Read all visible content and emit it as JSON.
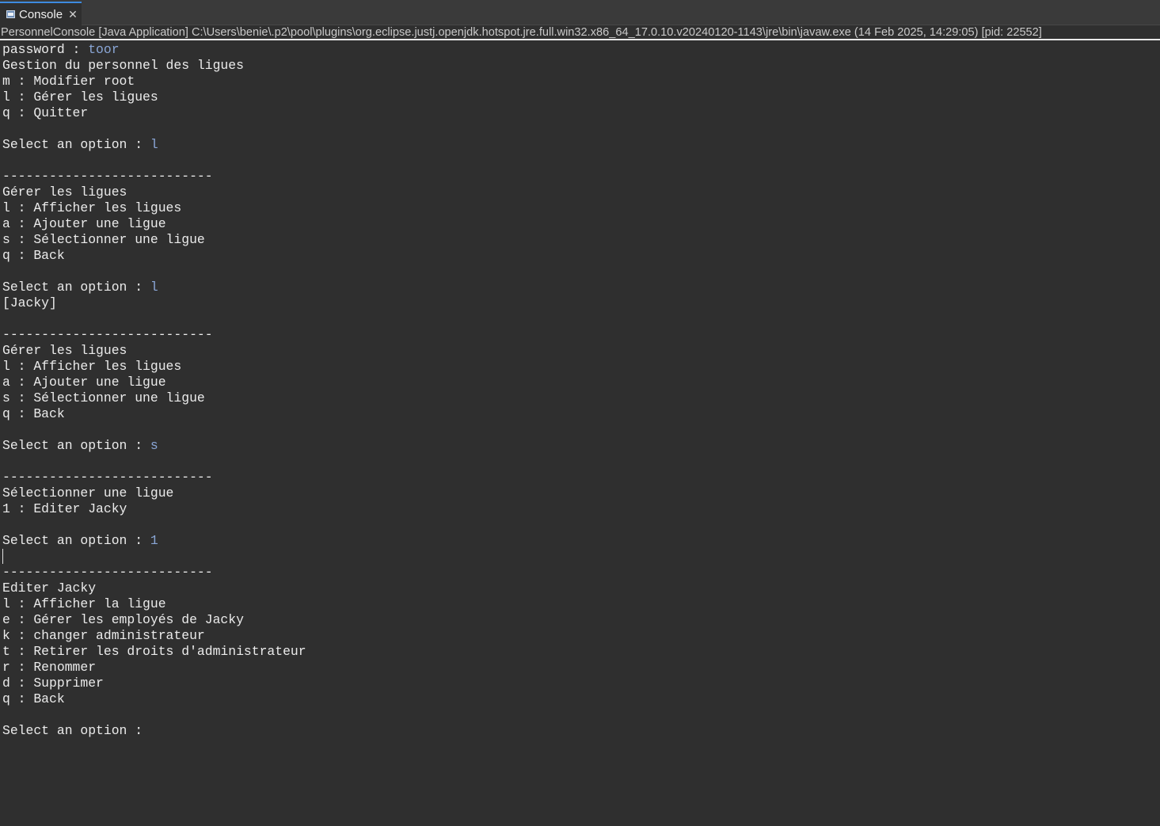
{
  "tab": {
    "icon": "console-icon",
    "label": "Console",
    "close_glyph": "✕"
  },
  "descriptor": "PersonnelConsole [Java Application] C:\\Users\\benie\\.p2\\pool\\plugins\\org.eclipse.justj.openjdk.hotspot.jre.full.win32.x86_64_17.0.10.v20240120-1143\\jre\\bin\\javaw.exe  (14 Feb 2025, 14:29:05) [pid: 22552]",
  "colors": {
    "background": "#2f2f2f",
    "output_text": "#ebebeb",
    "user_input": "#8aa6d6",
    "tab_accent": "#3d8be0"
  },
  "console_lines": [
    {
      "text": "password : ",
      "input": "toor"
    },
    {
      "text": "Gestion du personnel des ligues"
    },
    {
      "text": "m : Modifier root"
    },
    {
      "text": "l : Gérer les ligues"
    },
    {
      "text": "q : Quitter"
    },
    {
      "text": ""
    },
    {
      "text": "Select an option : ",
      "input": "l"
    },
    {
      "text": ""
    },
    {
      "text": "---------------------------"
    },
    {
      "text": "Gérer les ligues"
    },
    {
      "text": "l : Afficher les ligues"
    },
    {
      "text": "a : Ajouter une ligue"
    },
    {
      "text": "s : Sélectionner une ligue"
    },
    {
      "text": "q : Back"
    },
    {
      "text": ""
    },
    {
      "text": "Select an option : ",
      "input": "l"
    },
    {
      "text": "[Jacky]"
    },
    {
      "text": ""
    },
    {
      "text": "---------------------------"
    },
    {
      "text": "Gérer les ligues"
    },
    {
      "text": "l : Afficher les ligues"
    },
    {
      "text": "a : Ajouter une ligue"
    },
    {
      "text": "s : Sélectionner une ligue"
    },
    {
      "text": "q : Back"
    },
    {
      "text": ""
    },
    {
      "text": "Select an option : ",
      "input": "s"
    },
    {
      "text": ""
    },
    {
      "text": "---------------------------"
    },
    {
      "text": "Sélectionner une ligue"
    },
    {
      "text": "1 : Editer Jacky"
    },
    {
      "text": ""
    },
    {
      "text": "Select an option : ",
      "input": "1"
    },
    {
      "text": "",
      "caret": true
    },
    {
      "text": "---------------------------"
    },
    {
      "text": "Editer Jacky"
    },
    {
      "text": "l : Afficher la ligue"
    },
    {
      "text": "e : Gérer les employés de Jacky"
    },
    {
      "text": "k : changer administrateur"
    },
    {
      "text": "t : Retirer les droits d'administrateur"
    },
    {
      "text": "r : Renommer"
    },
    {
      "text": "d : Supprimer"
    },
    {
      "text": "q : Back"
    },
    {
      "text": ""
    },
    {
      "text": "Select an option : "
    }
  ]
}
